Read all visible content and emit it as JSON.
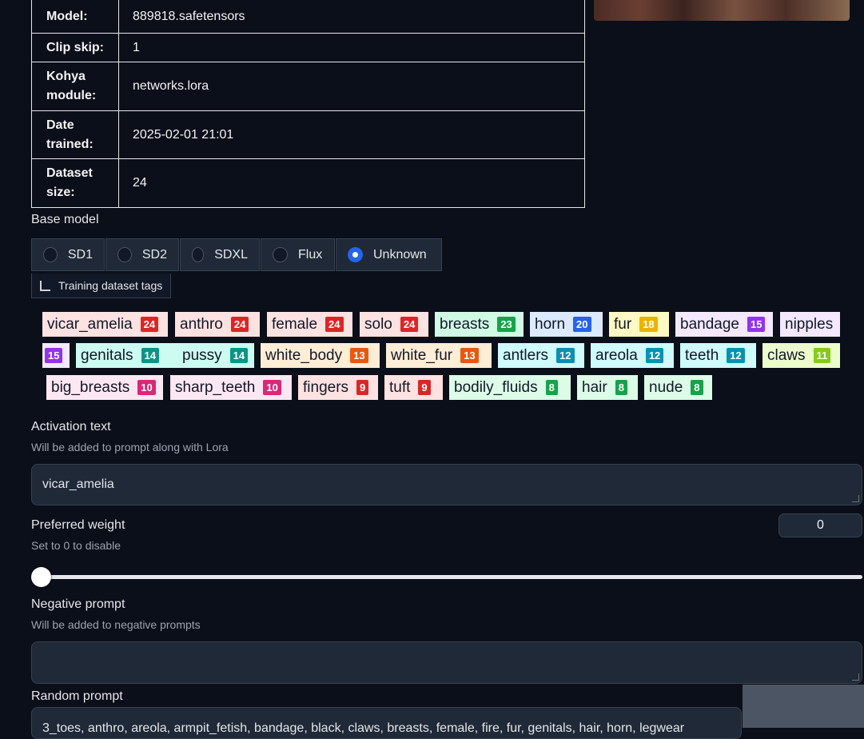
{
  "info_rows": [
    {
      "key": "Model:",
      "value": "889818.safetensors"
    },
    {
      "key": "Clip skip:",
      "value": "1"
    },
    {
      "key": "Kohya module:",
      "value": "networks.lora"
    },
    {
      "key": "Date trained:",
      "value": "2025-02-01 21:01"
    },
    {
      "key": "Dataset size:",
      "value": "24"
    }
  ],
  "base_model": {
    "label": "Base model",
    "options": [
      "SD1",
      "SD2",
      "SDXL",
      "Flux",
      "Unknown"
    ],
    "selected": "Unknown"
  },
  "dataset_tags_button": "Training dataset tags",
  "tags": [
    {
      "name": "vicar_amelia",
      "count": "24",
      "bg": "#fde2e2",
      "badge": "#dc2626"
    },
    {
      "name": "anthro",
      "count": "24",
      "bg": "#fde2e2",
      "badge": "#dc2626"
    },
    {
      "name": "female",
      "count": "24",
      "bg": "#fde2e2",
      "badge": "#dc2626"
    },
    {
      "name": "solo",
      "count": "24",
      "bg": "#fde2e2",
      "badge": "#dc2626"
    },
    {
      "name": "breasts",
      "count": "23",
      "bg": "#d1fae5",
      "badge": "#16a34a"
    },
    {
      "name": "horn",
      "count": "20",
      "bg": "#dbeafe",
      "badge": "#2563eb"
    },
    {
      "name": "fur",
      "count": "18",
      "bg": "#fef9c3",
      "badge": "#eab308"
    },
    {
      "name": "bandage",
      "count": "15",
      "bg": "#f3e8ff",
      "badge": "#9333ea"
    },
    {
      "name": "nipples",
      "count": "15",
      "bg": "#f3e8ff",
      "badge": "#9333ea"
    },
    {
      "name": "genitals",
      "count": "14",
      "bg": "#ccfbf1",
      "badge": "#0d9488"
    },
    {
      "name": "pussy",
      "count": "14",
      "bg": "#ccfbf1",
      "badge": "#0d9488"
    },
    {
      "name": "white_body",
      "count": "13",
      "bg": "#ffedd5",
      "badge": "#ea580c"
    },
    {
      "name": "white_fur",
      "count": "13",
      "bg": "#ffedd5",
      "badge": "#ea580c"
    },
    {
      "name": "antlers",
      "count": "12",
      "bg": "#cffafe",
      "badge": "#0891b2"
    },
    {
      "name": "areola",
      "count": "12",
      "bg": "#cffafe",
      "badge": "#0891b2"
    },
    {
      "name": "teeth",
      "count": "12",
      "bg": "#cffafe",
      "badge": "#0891b2"
    },
    {
      "name": "claws",
      "count": "11",
      "bg": "#ecfccb",
      "badge": "#84cc16"
    },
    {
      "name": "big_breasts",
      "count": "10",
      "bg": "#fce7f3",
      "badge": "#db2777"
    },
    {
      "name": "sharp_teeth",
      "count": "10",
      "bg": "#fce7f3",
      "badge": "#db2777"
    },
    {
      "name": "fingers",
      "count": "9",
      "bg": "#fee2e2",
      "badge": "#dc2626"
    },
    {
      "name": "tuft",
      "count": "9",
      "bg": "#fee2e2",
      "badge": "#dc2626"
    },
    {
      "name": "bodily_fluids",
      "count": "8",
      "bg": "#dcfce7",
      "badge": "#16a34a"
    },
    {
      "name": "hair",
      "count": "8",
      "bg": "#dcfce7",
      "badge": "#16a34a"
    },
    {
      "name": "nude",
      "count": "8",
      "bg": "#dcfce7",
      "badge": "#16a34a"
    }
  ],
  "activation": {
    "label": "Activation text",
    "info": "Will be added to prompt along with Lora",
    "value": "vicar_amelia"
  },
  "weight": {
    "label": "Preferred weight",
    "info": "Set to 0 to disable",
    "value": "0",
    "slider_fraction": 0
  },
  "negative": {
    "label": "Negative prompt",
    "info": "Will be added to negative prompts",
    "value": ""
  },
  "random_prompt": {
    "label": "Random prompt",
    "value": "3_toes, anthro, areola, armpit_fetish, bandage, black, claws, breasts, female, fire, fur, genitals, hair, horn, legwear"
  }
}
